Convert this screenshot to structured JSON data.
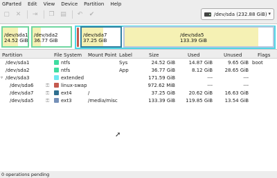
{
  "menu": [
    "GParted",
    "Edit",
    "View",
    "Device",
    "Partition",
    "Help"
  ],
  "toolbar": {
    "icons": [
      "new-icon",
      "delete-icon",
      "resize-icon",
      "copy-icon",
      "paste-icon",
      "undo-icon",
      "apply-icon"
    ]
  },
  "device": {
    "label": "/dev/sda  (232.88 GiB)"
  },
  "graph": {
    "partitions": [
      {
        "name": "/dev/sda1",
        "size": "24.52 GiB",
        "used_fraction": 0.6
      },
      {
        "name": "/dev/sda2",
        "size": "36.77 GiB",
        "used_fraction": 0.22
      },
      {
        "name": "/dev/sda7",
        "size": "37.25 GiB",
        "used_fraction": 0.55
      },
      {
        "name": "/dev/sda5",
        "size": "133.39 GiB",
        "used_fraction": 0.9
      }
    ]
  },
  "columns": [
    "Partition",
    "File System",
    "Mount Point",
    "Label",
    "Size",
    "Used",
    "Unused",
    "Flags"
  ],
  "rows": [
    {
      "partition": "/dev/sda1",
      "fs": "ntfs",
      "fs_color": "#3fdca0",
      "mount": "",
      "label": "Sys",
      "size": "24.52 GiB",
      "used": "14.87 GiB",
      "unused": "9.65 GiB",
      "flags": "boot",
      "locked": false,
      "indent": 1
    },
    {
      "partition": "/dev/sda2",
      "fs": "ntfs",
      "fs_color": "#3fdca0",
      "mount": "",
      "label": "App",
      "size": "36.77 GiB",
      "used": "8.12 GiB",
      "unused": "28.65 GiB",
      "flags": "",
      "locked": false,
      "indent": 1
    },
    {
      "partition": "/dev/sda3",
      "fs": "extended",
      "fs_color": "#6fe8f0",
      "mount": "",
      "label": "",
      "size": "171.59 GiB",
      "used": "---",
      "unused": "---",
      "flags": "",
      "locked": false,
      "indent": 1,
      "expander": true
    },
    {
      "partition": "/dev/sda6",
      "fs": "linux-swap",
      "fs_color": "#c45a4f",
      "mount": "",
      "label": "",
      "size": "972.62 MiB",
      "used": "---",
      "unused": "---",
      "flags": "",
      "locked": true,
      "indent": 2
    },
    {
      "partition": "/dev/sda7",
      "fs": "ext4",
      "fs_color": "#2f6f8f",
      "mount": "/",
      "label": "",
      "size": "37.25 GiB",
      "used": "20.62 GiB",
      "unused": "16.63 GiB",
      "flags": "",
      "locked": true,
      "indent": 2
    },
    {
      "partition": "/dev/sda5",
      "fs": "ext3",
      "fs_color": "#7590b8",
      "mount": "/media/misc",
      "label": "",
      "size": "133.39 GiB",
      "used": "119.85 GiB",
      "unused": "13.54 GiB",
      "flags": "",
      "locked": true,
      "indent": 2
    }
  ],
  "status": "0 operations pending"
}
